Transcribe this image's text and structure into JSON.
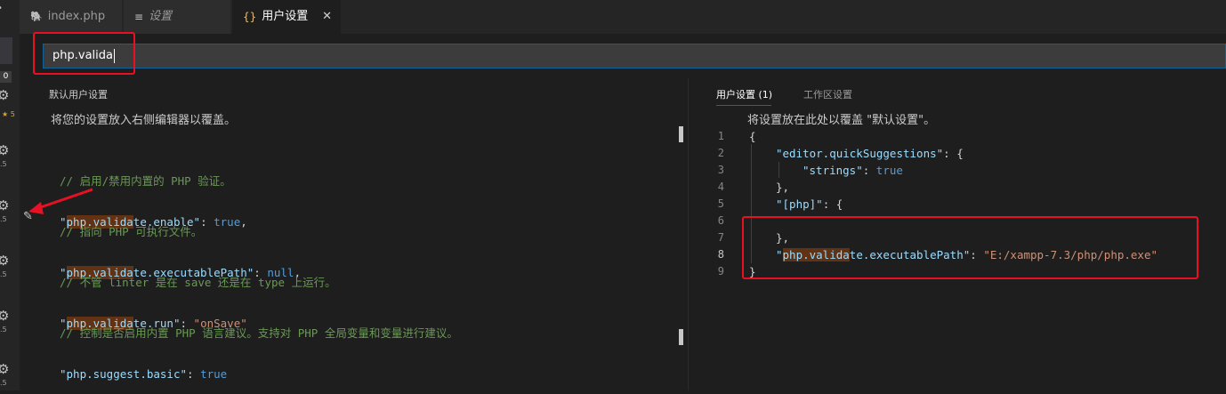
{
  "tabs": [
    {
      "label": "index.php",
      "icon": "php-elephant-icon",
      "active": false
    },
    {
      "label": "设置",
      "icon": "lines-icon",
      "active": false
    },
    {
      "label": "用户设置",
      "icon": "braces-icon",
      "active": true
    }
  ],
  "tab_close_glyph": "✕",
  "search": {
    "value": "php.valida"
  },
  "activity": {
    "badge": "0",
    "stars": "★ 5",
    "versions": [
      ".5",
      ".5",
      ".5",
      ".5",
      ".5",
      "."
    ]
  },
  "left": {
    "header": "默认用户设置",
    "description": "将您的设置放入右侧编辑器以覆盖。",
    "settings": [
      {
        "comment": "// 启用/禁用内置的 PHP 验证。",
        "key_hl": "php.valida",
        "key_rest": "te.enable",
        "value": "true",
        "value_type": "kw"
      },
      {
        "comment": "// 指向 PHP 可执行文件。",
        "key_hl": "php.valida",
        "key_rest": "te.executablePath",
        "value": "null",
        "value_type": "kw"
      },
      {
        "comment": "// 不管 linter 是在 save 还是在 type 上运行。",
        "key_hl": "php.valida",
        "key_rest": "te.run",
        "value": "\"onSave\"",
        "value_type": "str"
      },
      {
        "comment": "// 控制是否启用内置 PHP 语言建议。支持对 PHP 全局变量和变量进行建议。",
        "key_hl": "",
        "key_rest": "php.suggest.basic",
        "value": "true",
        "value_type": "kw"
      }
    ]
  },
  "right": {
    "tab_user": "用户设置 (1)",
    "tab_workspace": "工作区设置",
    "description": "将设置放在此处以覆盖 \"默认设置\"。",
    "lines": [
      {
        "num": "1",
        "text": "{"
      },
      {
        "num": "2",
        "key": "\"editor.quickSuggestions\"",
        "rest": ": {"
      },
      {
        "num": "3",
        "key": "\"strings\"",
        "rest": ": ",
        "value": "true"
      },
      {
        "num": "4",
        "text": "},"
      },
      {
        "num": "5",
        "key": "\"[php]\"",
        "rest": ": {"
      },
      {
        "num": "6",
        "text": ""
      },
      {
        "num": "7",
        "text": "},"
      },
      {
        "num": "8",
        "key_hl": "php.valida",
        "key_rest": "te.executablePath",
        "rest": ": ",
        "value": "\"E:/xampp-7.3/php/php.exe\""
      },
      {
        "num": "9",
        "text": "}"
      }
    ]
  },
  "colors": {
    "accent": "#0e639c",
    "annotation": "#e81123",
    "match_highlight": "#613214"
  }
}
